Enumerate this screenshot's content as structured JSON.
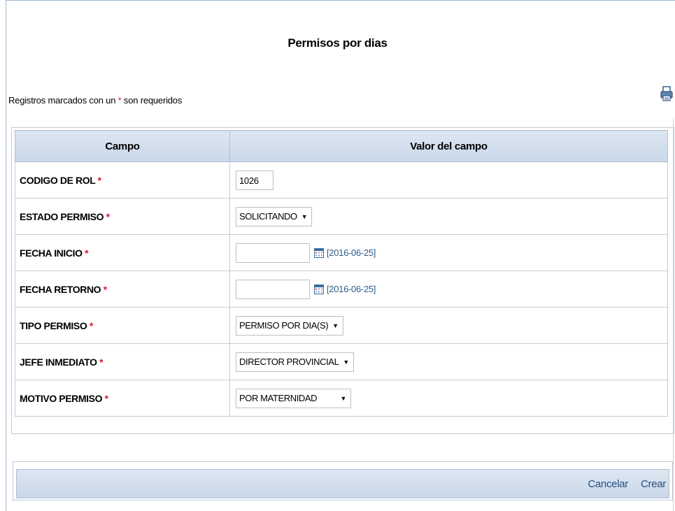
{
  "page": {
    "title": "Permisos por dias",
    "required_note_prefix": "Registros marcados con un ",
    "required_mark": "*",
    "required_note_suffix": " son requeridos"
  },
  "grid": {
    "headers": [
      "Campo",
      "Valor del campo"
    ],
    "rows": [
      {
        "label": "CODIGO DE ROL",
        "kind": "text",
        "value": "1026"
      },
      {
        "label": "ESTADO PERMISO",
        "kind": "select",
        "value": "SOLICITANDO"
      },
      {
        "label": "FECHA INICIO",
        "kind": "date",
        "value": "",
        "hint": "[2016-06-25]"
      },
      {
        "label": "FECHA RETORNO",
        "kind": "date",
        "value": "",
        "hint": "[2016-06-25]"
      },
      {
        "label": "TIPO PERMISO",
        "kind": "select",
        "value": "PERMISO POR DIA(S)"
      },
      {
        "label": "JEFE INMEDIATO",
        "kind": "select",
        "value": "DIRECTOR PROVINCIAL"
      },
      {
        "label": "MOTIVO PERMISO",
        "kind": "select",
        "value": "POR MATERNIDAD"
      }
    ]
  },
  "actions": {
    "cancel": "Cancelar",
    "create": "Crear"
  },
  "icons": {
    "print": "printer-icon",
    "calendar": "calendar-icon",
    "dropdown": "chevron-down-icon"
  },
  "colors": {
    "required": "#e0152e",
    "header_bg": "#d3dfed",
    "link": "#254f7d"
  }
}
